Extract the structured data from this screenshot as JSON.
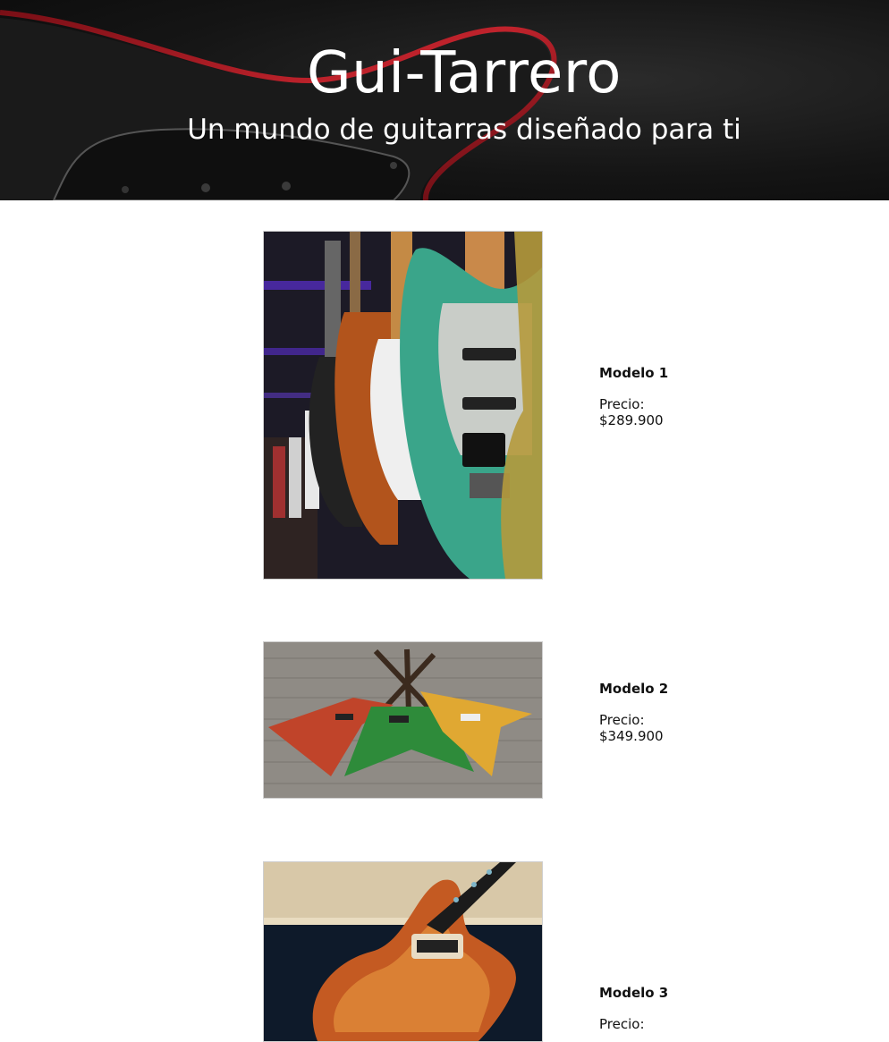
{
  "header": {
    "title": "Gui-Tarrero",
    "subtitle": "Un mundo de guitarras diseñado para ti"
  },
  "products": [
    {
      "name": "Modelo 1",
      "price_label": "Precio:",
      "price": "$289.900"
    },
    {
      "name": "Modelo 2",
      "price_label": "Precio:",
      "price": "$349.900"
    },
    {
      "name": "Modelo 3",
      "price_label": "Precio:",
      "price": ""
    }
  ],
  "colors": {
    "header_bg": "#111111",
    "header_text": "#ffffff",
    "page_bg": "#ffffff"
  }
}
